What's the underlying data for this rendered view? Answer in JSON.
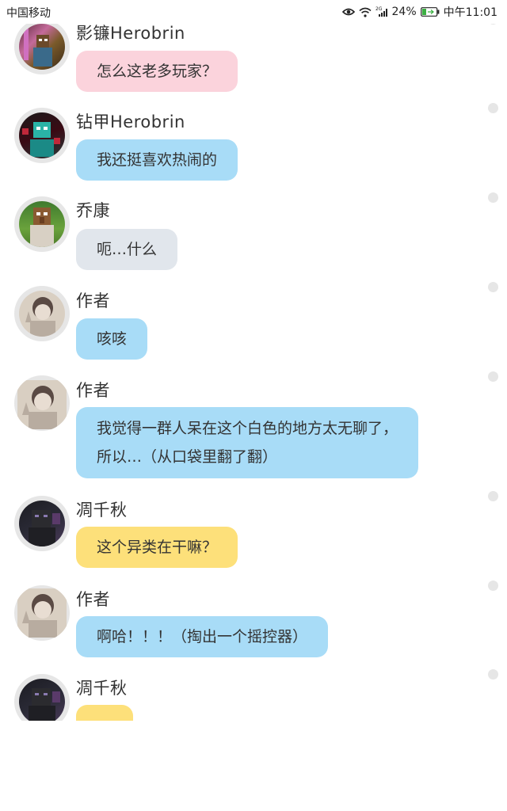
{
  "status_bar": {
    "carrier": "中国移动",
    "network": "2G",
    "battery": "24%",
    "time": "中午11:01"
  },
  "colors": {
    "pink": "#fbd3dc",
    "blue": "#a8dcf7",
    "gray": "#e1e6ec",
    "yellow": "#fde07a"
  },
  "messages": [
    {
      "name": "影镰Herobrin",
      "text": "怎么这老多玩家？",
      "bubble_color": "pink",
      "avatar": "herobrine-pink-avatar"
    },
    {
      "name": "钻甲Herobrin",
      "text": "我还挺喜欢热闹的",
      "bubble_color": "blue",
      "avatar": "herobrine-diamond-avatar"
    },
    {
      "name": "乔康",
      "text": "呃…什么",
      "bubble_color": "gray",
      "avatar": "villager-avatar"
    },
    {
      "name": "作者",
      "text": "咳咳",
      "bubble_color": "blue",
      "avatar": "author-avatar"
    },
    {
      "name": "作者",
      "text_lines": [
        "我觉得一群人呆在这个白色的地方太无聊了，",
        "所以…（从口袋里翻了翻）"
      ],
      "bubble_color": "blue",
      "avatar": "author-avatar"
    },
    {
      "name": "凋千秋",
      "text": "这个异类在干嘛？",
      "bubble_color": "yellow",
      "avatar": "wither-avatar"
    },
    {
      "name": "作者",
      "text": "啊哈！！！（掏出一个摇控器）",
      "bubble_color": "blue",
      "avatar": "author-avatar"
    },
    {
      "name": "凋千秋",
      "text": "",
      "bubble_color": "yellow",
      "avatar": "wither-avatar"
    }
  ]
}
